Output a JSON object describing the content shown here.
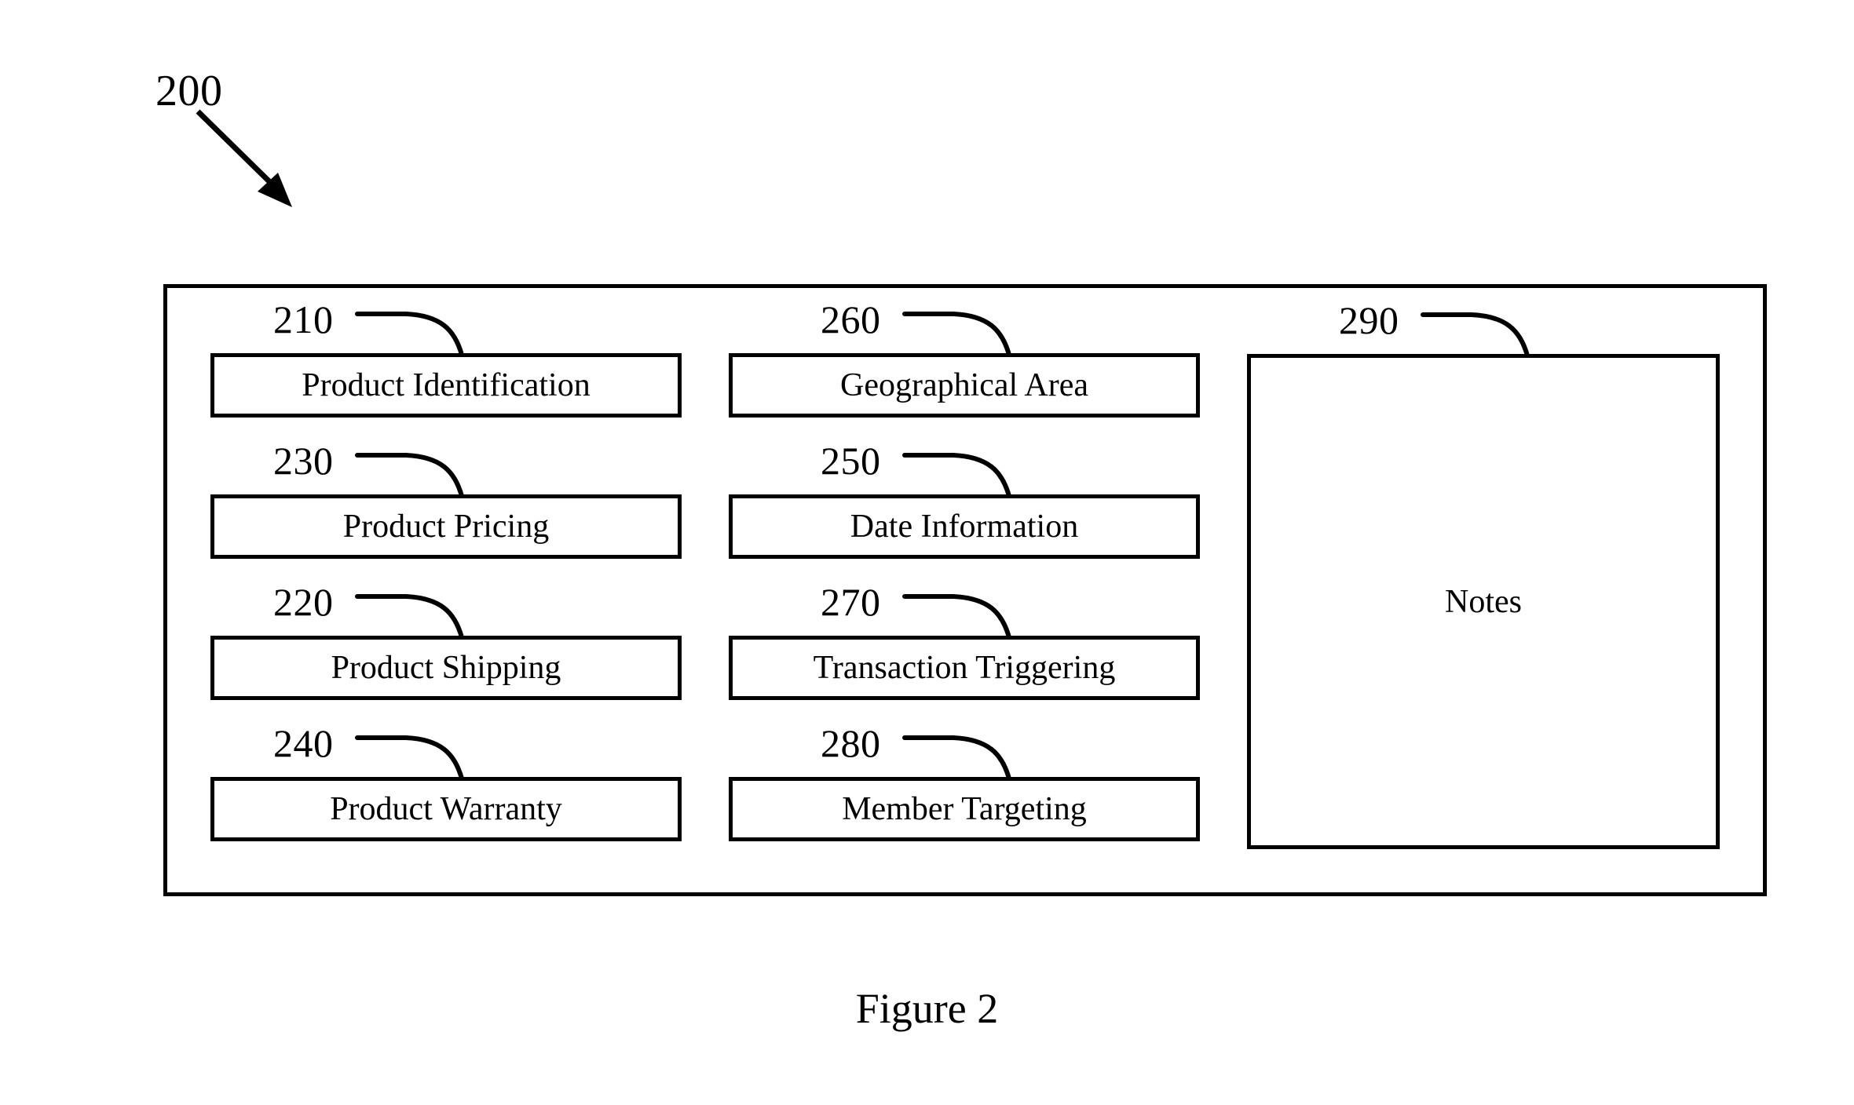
{
  "figure": {
    "ref_numeral": "200",
    "caption": "Figure 2"
  },
  "diagram": {
    "columns": [
      {
        "name": "left-column",
        "boxes": [
          {
            "ref": "210",
            "label": "Product Identification"
          },
          {
            "ref": "230",
            "label": "Product Pricing"
          },
          {
            "ref": "220",
            "label": "Product Shipping"
          },
          {
            "ref": "240",
            "label": "Product Warranty"
          }
        ]
      },
      {
        "name": "middle-column",
        "boxes": [
          {
            "ref": "260",
            "label": "Geographical Area"
          },
          {
            "ref": "250",
            "label": "Date Information"
          },
          {
            "ref": "270",
            "label": "Transaction Triggering"
          },
          {
            "ref": "280",
            "label": "Member Targeting"
          }
        ]
      }
    ],
    "notes_panel": {
      "ref": "290",
      "label": "Notes"
    }
  },
  "style": {
    "ink_color": "#000000",
    "background_color": "#ffffff"
  }
}
